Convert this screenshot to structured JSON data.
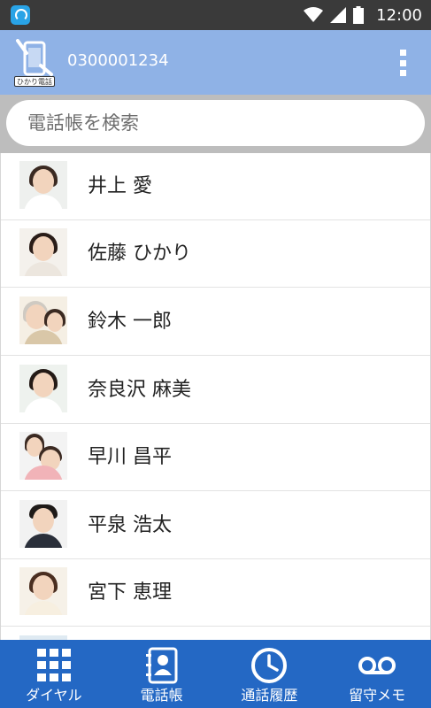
{
  "status_bar": {
    "time": "12:00"
  },
  "app_bar": {
    "logo_label": "ひかり電話",
    "phone_number": "0300001234"
  },
  "search": {
    "placeholder": "電話帳を検索"
  },
  "contacts": [
    {
      "name": "井上 愛"
    },
    {
      "name": "佐藤 ひかり"
    },
    {
      "name": "鈴木 一郎"
    },
    {
      "name": "奈良沢 麻美"
    },
    {
      "name": "早川 昌平"
    },
    {
      "name": "平泉 浩太"
    },
    {
      "name": "宮下 恵理"
    }
  ],
  "bottom_nav": [
    {
      "label": "ダイヤル",
      "icon": "dialpad-icon"
    },
    {
      "label": "電話帳",
      "icon": "phonebook-icon"
    },
    {
      "label": "通話履歴",
      "icon": "history-icon"
    },
    {
      "label": "留守メモ",
      "icon": "voicemail-icon"
    }
  ],
  "colors": {
    "app_bar": "#8fb2e6",
    "bottom_nav": "#2468c4",
    "status_bar": "#3a3a3a"
  }
}
